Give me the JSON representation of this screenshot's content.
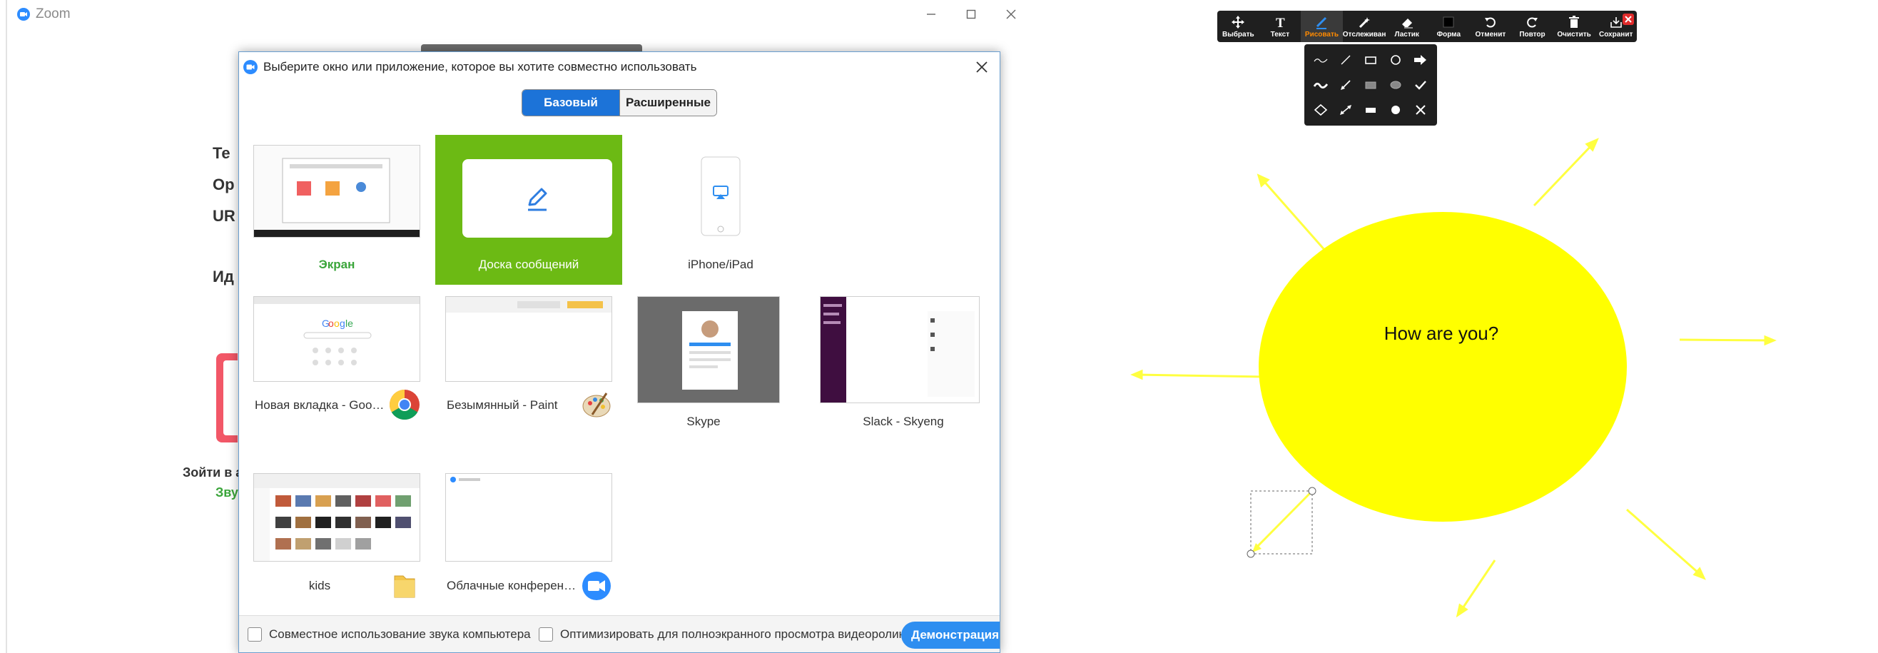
{
  "window": {
    "app_title": "Zoom",
    "bg_labels": [
      "Те",
      "Ор",
      "UR",
      "Ид"
    ],
    "bg_join_text": "Зойти в а",
    "bg_green_text": "Зву"
  },
  "dialog": {
    "title": "Выберите окно или приложение, которое вы хотите совместно использовать",
    "tabs": {
      "basic": "Базовый",
      "advanced": "Расширенные"
    },
    "tiles": [
      {
        "label": "Экран",
        "icon": "screen-thumbnail"
      },
      {
        "label": "Доска сообщений",
        "icon": "pencil-icon"
      },
      {
        "label": "iPhone/iPad",
        "icon": "airplay-icon"
      },
      {
        "label": "Новая вкладка - Google...",
        "icon": "chrome-icon"
      },
      {
        "label": "Безымянный - Paint",
        "icon": "paint-palette-icon"
      },
      {
        "label": "Skype",
        "icon": "skype-thumbnail"
      },
      {
        "label": "Slack - Skyeng",
        "icon": "slack-thumbnail"
      },
      {
        "label": "kids",
        "icon": "folder-icon"
      },
      {
        "label": "Облачные конференци...",
        "icon": "zoom-camera-icon"
      }
    ],
    "footer": {
      "share_audio": "Совместное использование звука компьютера",
      "optimize_video": "Оптимизировать для полноэкранного просмотра видеоролика",
      "share_button": "Демонстрация"
    }
  },
  "whiteboard": {
    "toolbar": [
      {
        "label": "Выбрать",
        "icon": "move-icon"
      },
      {
        "label": "Текст",
        "icon": "text-icon"
      },
      {
        "label": "Рисовать",
        "icon": "draw-icon",
        "active": true
      },
      {
        "label": "Отслеживан",
        "icon": "spotlight-icon"
      },
      {
        "label": "Ластик",
        "icon": "eraser-icon"
      },
      {
        "label": "Форма",
        "icon": "format-icon"
      },
      {
        "label": "Отменит",
        "icon": "undo-icon"
      },
      {
        "label": "Повтор",
        "icon": "redo-icon"
      },
      {
        "label": "Очистить",
        "icon": "trash-icon"
      },
      {
        "label": "Сохранит",
        "icon": "save-icon"
      }
    ],
    "canvas_text": "How are you?",
    "colors": {
      "sun": "#ffff00",
      "accent": "#2e8ef0",
      "selected_tile": "#6cba14"
    }
  }
}
